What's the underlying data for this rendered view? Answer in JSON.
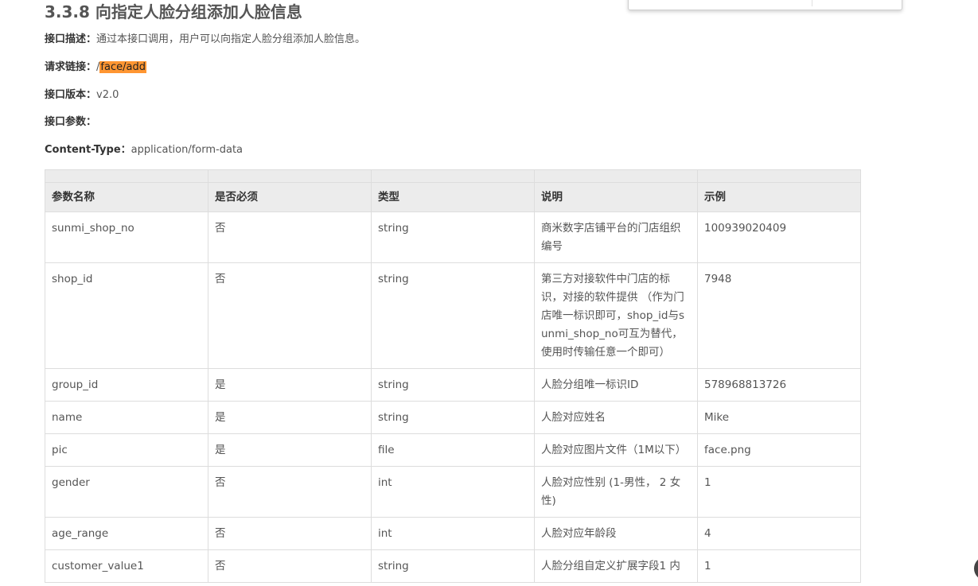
{
  "section": {
    "title": "3.3.8 向指定人脸分组添加人脸信息"
  },
  "meta": {
    "desc_label": "接口描述：",
    "desc_value": "通过本接口调用，用户可以向指定人脸分组添加人脸信息。",
    "url_label": "请求链接：",
    "url_prefix": "/",
    "url_path": "face/add",
    "version_label": "接口版本：",
    "version_value": "v2.0",
    "params_label": "接口参数：",
    "content_type_label": "Content-Type：",
    "content_type_value": "application/form-data"
  },
  "table": {
    "headers": [
      "参数名称",
      "是否必须",
      "类型",
      "说明",
      "示例"
    ],
    "rows": [
      [
        "sunmi_shop_no",
        "否",
        "string",
        "商米数字店铺平台的门店组织编号",
        "100939020409"
      ],
      [
        "shop_id",
        "否",
        "string",
        "第三方对接软件中门店的标识，对接的软件提供 （作为门店唯一标识即可，shop_id与sunmi_shop_no可互为替代，使用时传输任意一个即可）",
        "7948"
      ],
      [
        "group_id",
        "是",
        "string",
        "人脸分组唯一标识ID",
        "578968813726"
      ],
      [
        "name",
        "是",
        "string",
        "人脸对应姓名",
        "Mike"
      ],
      [
        "pic",
        "是",
        "file",
        "人脸对应图片文件（1M以下）",
        "face.png"
      ],
      [
        "gender",
        "否",
        "int",
        "人脸对应性别 (1-男性， 2 女性)",
        "1"
      ],
      [
        "age_range",
        "否",
        "int",
        "人脸对应年龄段",
        "4"
      ],
      [
        "customer_value1",
        "否",
        "string",
        "人脸分组自定义扩展字段1 内",
        "1"
      ]
    ]
  },
  "colors": {
    "highlight": "#ff9632",
    "header_bg": "#ececec",
    "border": "#dddddd"
  }
}
